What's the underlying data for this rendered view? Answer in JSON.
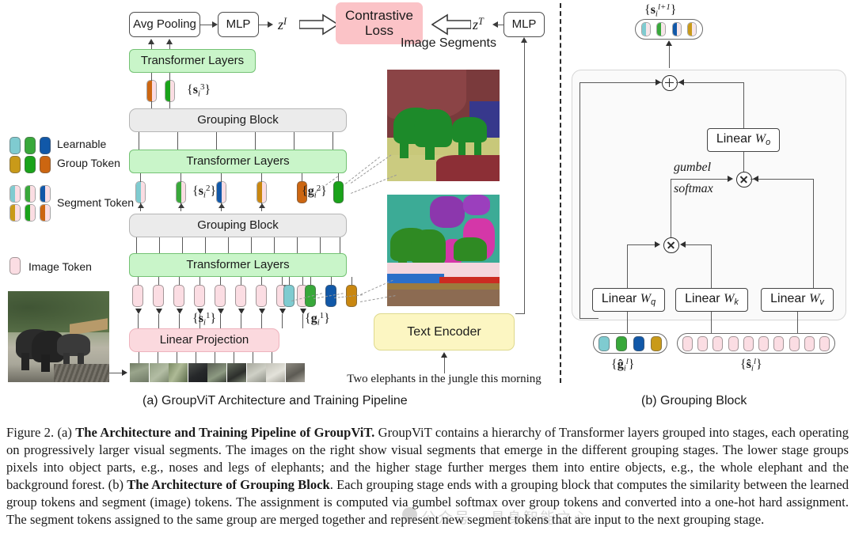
{
  "figure": {
    "number": "Figure 2.",
    "subcaption_a": "(a) GroupViT Architecture and Training Pipeline",
    "subcaption_b": "(b) Grouping Block",
    "caption_runs": [
      {
        "text": "Figure 2. (a) ",
        "bold": false
      },
      {
        "text": "The Architecture and Training Pipeline of GroupViT.",
        "bold": true
      },
      {
        "text": " GroupViT contains a hierarchy of Transformer layers grouped into stages, each operating on progressively larger visual segments. The images on the right show visual segments that emerge in the different grouping stages. The lower stage groups pixels into object parts, e.g., noses and legs of elephants; and the higher stage further merges them into entire objects, e.g., the whole elephant and the background forest.  (b) ",
        "bold": false
      },
      {
        "text": "The Architecture of Grouping Block",
        "bold": true
      },
      {
        "text": ". Each grouping stage ends with a grouping block that computes the similarity between the learned group tokens and segment (image) tokens. The assignment is computed via gumbel softmax over group tokens and converted into a one-hot hard assignment. The segment tokens assigned to the same group are merged together and represent new segment tokens that are input to the next grouping stage.",
        "bold": false
      }
    ]
  },
  "left_panel": {
    "blocks": {
      "avg_pooling": "Avg Pooling",
      "mlp_image": "MLP",
      "mlp_text": "MLP",
      "contrastive_loss": "Contrastive\nLoss",
      "transformer_3": "Transformer Layers",
      "transformer_2": "Transformer Layers",
      "transformer_1": "Transformer Layers",
      "grouping_block_2": "Grouping Block",
      "grouping_block_1": "Grouping Block",
      "linear_projection": "Linear Projection",
      "text_encoder": "Text Encoder"
    },
    "labels": {
      "z_image": "z^I",
      "z_text": "z^T",
      "image_segments": "Image Segments",
      "caption_sentence": "Two elephants in the jungle this morning",
      "s3": "{s_i^3}",
      "s2": "{s_i^2}",
      "s1": "{s_i^1}",
      "g2": "{g_i^2}",
      "g1": "{g_i^1}"
    },
    "legend": [
      {
        "name": "learnable-group-token",
        "line1": "Learnable",
        "line2": "Group Token"
      },
      {
        "name": "segment-token",
        "line1": "Segment Token",
        "line2": ""
      },
      {
        "name": "image-token",
        "line1": "Image Token",
        "line2": ""
      }
    ]
  },
  "right_panel": {
    "labels": {
      "output_tokens": "{s_i^{l+1}}",
      "group_tokens": "{ĝ_i^l}",
      "segment_tokens": "{ŝ_i^l}",
      "gumbel": "gumbel",
      "softmax": "softmax"
    },
    "blocks": {
      "linear_wo": "Linear W_o",
      "linear_wq": "Linear W_q",
      "linear_wk": "Linear W_k",
      "linear_wv": "Linear W_v"
    },
    "operators": {
      "add": "+",
      "multiply_top": "×",
      "multiply_bottom": "×"
    }
  },
  "colors": {
    "group_teal": "#7fcbd0",
    "group_green": "#38a83a",
    "group_blue": "#1158a8",
    "group_orange": "#c98710",
    "group_orange_dark": "#cc6611",
    "group_gold": "#c99a19",
    "image_token_pink": "#fbdde3",
    "transformer_green": "#c9f5c9",
    "grouping_grey": "#ebebeb",
    "linear_proj_pink": "#fbd9de",
    "loss_red": "#fbc3c7",
    "text_encoder_yellow": "#fcf6c2"
  },
  "watermark": "公众号 · 具身智能之心"
}
